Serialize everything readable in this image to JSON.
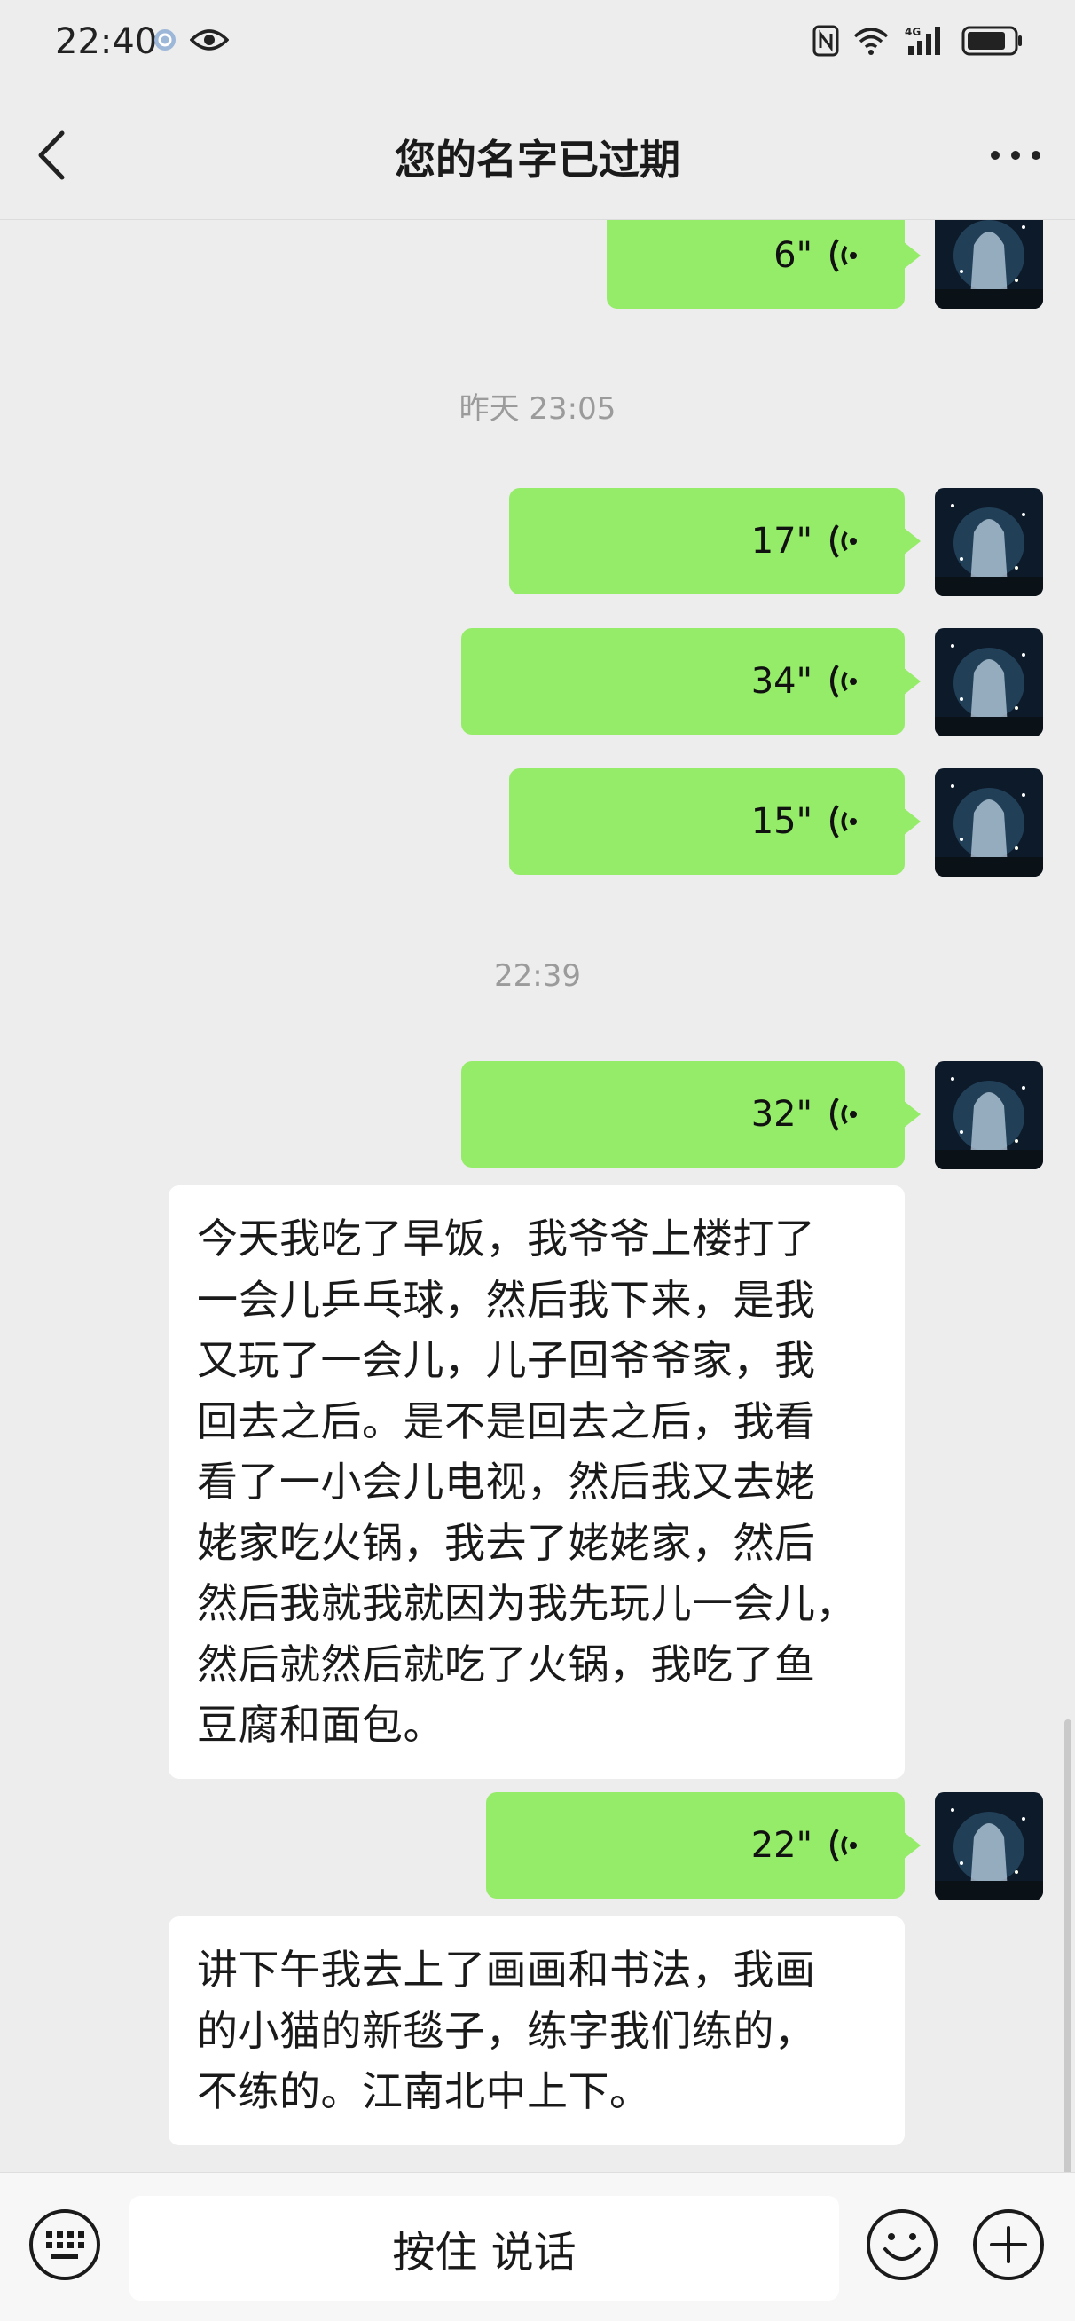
{
  "status": {
    "time": "22:40",
    "network": "4G"
  },
  "header": {
    "title": "您的名字已过期"
  },
  "timestamps": {
    "t1": "昨天 23:05",
    "t2": "22:39"
  },
  "messages": {
    "v0": "6\"",
    "v1": "17\"",
    "v2": "34\"",
    "v3": "15\"",
    "v4": "32\"",
    "tx1": "今天我吃了早饭，我爷爷上楼打了\n一会儿乒乓球，然后我下来，是我\n又玩了一会儿，儿子回爷爷家，我\n回去之后。是不是回去之后，我看\n看了一小会儿电视，然后我又去姥\n姥家吃火锅，我去了姥姥家，然后\n然后我就我就因为我先玩儿一会儿，\n然后就然后就吃了火锅，我吃了鱼\n豆腐和面包。",
    "v5": "22\"",
    "tx2": "讲下午我去上了画画和书法，我画\n的小猫的新毯子，练字我们练的，\n不练的。江南北中上下。"
  },
  "input_bar": {
    "hold_to_talk": "按住 说话"
  },
  "colors": {
    "background": "#ededed",
    "sent_bubble": "#95ec69",
    "text_bubble": "#ffffff",
    "timestamp": "#9b9b9b"
  },
  "icons": [
    "nfc-icon",
    "wifi-icon",
    "signal-icon",
    "battery-icon",
    "back-icon",
    "more-icon",
    "voice-wave-icon",
    "keyboard-icon",
    "emoji-icon",
    "plus-icon"
  ]
}
